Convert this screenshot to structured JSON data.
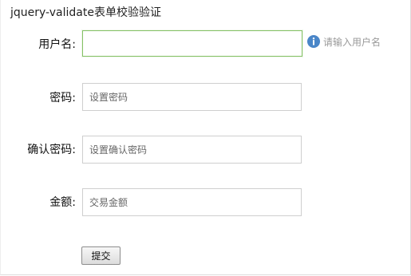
{
  "form": {
    "title": "jquery-validate表单校验验证",
    "username": {
      "label": "用户名:",
      "value": "",
      "placeholder": "",
      "hint": "请输入用户名"
    },
    "password": {
      "label": "密码:",
      "value": "",
      "placeholder": "设置密码"
    },
    "confirm_password": {
      "label": "确认密码:",
      "value": "",
      "placeholder": "设置确认密码"
    },
    "trade_amount": {
      "label": "金额:",
      "value": "",
      "placeholder": "交易金额"
    },
    "submit_label": "提交"
  },
  "icons": {
    "hint_icon": "info-icon"
  },
  "colors": {
    "focus_border": "#85c166",
    "info_icon": "#4a86c8",
    "hint_text": "#999999"
  }
}
